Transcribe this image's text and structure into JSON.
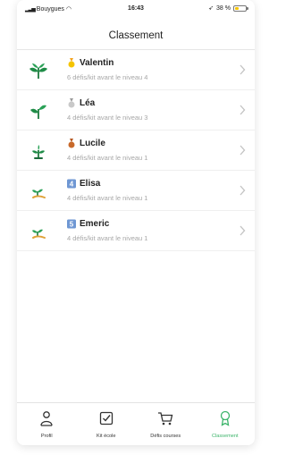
{
  "status_bar": {
    "carrier": "Bouygues",
    "time": "16:43",
    "battery": "38 %",
    "battery_level": 0.38,
    "battery_color": "#f5c400"
  },
  "header": {
    "title": "Classement"
  },
  "colors": {
    "accent": "#3cb46a",
    "secondary_text": "#a7a7a7",
    "divider": "#efefef"
  },
  "leaderboard": [
    {
      "name": "Valentin",
      "detail": "6 défis/kit avant le niveau 4",
      "badge": "gold-medal-icon",
      "plant": "large-plant-icon"
    },
    {
      "name": "Léa",
      "detail": "4 défis/kit avant le niveau 3",
      "badge": "silver-medal-icon",
      "plant": "medium-plant-icon"
    },
    {
      "name": "Lucile",
      "detail": "4 défis/kit avant le niveau 1",
      "badge": "bronze-medal-icon",
      "plant": "small-plant-icon"
    },
    {
      "name": "Elisa",
      "detail": "4 défis/kit avant le niveau 1",
      "badge": "rank-4-icon",
      "badge_text": "4",
      "plant": "sprout-icon"
    },
    {
      "name": "Emeric",
      "detail": "4 défis/kit avant le niveau 1",
      "badge": "rank-5-icon",
      "badge_text": "5",
      "plant": "sprout-icon"
    }
  ],
  "tabbar": {
    "tabs": [
      {
        "label": "Profil",
        "icon": "person-icon",
        "active": false
      },
      {
        "label": "Kit école",
        "icon": "checkbox-icon",
        "active": false
      },
      {
        "label": "Défis courses",
        "icon": "cart-icon",
        "active": false
      },
      {
        "label": "Classement",
        "icon": "trophy-icon",
        "active": true
      }
    ]
  }
}
